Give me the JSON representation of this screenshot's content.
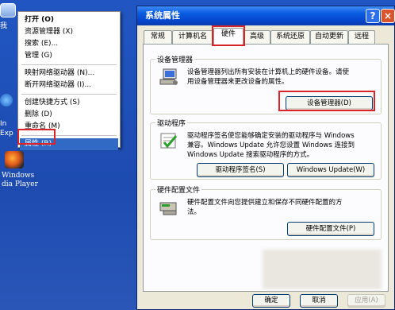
{
  "desktop": {
    "icon_partial_label": "我",
    "hidden_label_1": "In",
    "hidden_label_2": "Exp",
    "media_player_label_line1": "Windows",
    "media_player_label_line2": "dia Player"
  },
  "context_menu": {
    "items": [
      {
        "label": "打开 (O)"
      },
      {
        "label": "资源管理器 (X)"
      },
      {
        "label": "搜索 (E)..."
      },
      {
        "label": "管理 (G)"
      },
      {
        "label": "映射网络驱动器 (N)..."
      },
      {
        "label": "断开网络驱动器 (I)..."
      },
      {
        "label": "创建快捷方式 (S)"
      },
      {
        "label": "删除 (D)"
      },
      {
        "label": "重命名 (M)"
      },
      {
        "label": "属性 (R)"
      }
    ]
  },
  "dialog": {
    "title": "系统属性",
    "help_glyph": "?",
    "close_glyph": "×",
    "tabs": [
      {
        "label": "常规"
      },
      {
        "label": "计算机名"
      },
      {
        "label": "硬件"
      },
      {
        "label": "高级"
      },
      {
        "label": "系统还原"
      },
      {
        "label": "自动更新"
      },
      {
        "label": "远程"
      }
    ],
    "active_tab": "硬件",
    "device_manager": {
      "title": "设备管理器",
      "desc_line1": "设备管理器列出所有安装在计算机上的硬件设备。请使",
      "desc_line2": "用设备管理器来更改设备的属性。",
      "button": "设备管理器(D)"
    },
    "drivers": {
      "title": "驱动程序",
      "desc_line1": "驱动程序签名使您能够确定安装的驱动程序与 Windows",
      "desc_line2": "兼容。Windows Update 允许您设置 Windows 连接到",
      "desc_line3": "Windows Update 搜索驱动程序的方式。",
      "button_signing": "驱动程序签名(S)",
      "button_update": "Windows Update(W)"
    },
    "hardware_profiles": {
      "title": "硬件配置文件",
      "desc_line1": "硬件配置文件向您提供建立和保存不同硬件配置的方",
      "desc_line2": "法。",
      "button": "硬件配置文件(P)"
    },
    "footer": {
      "ok": "确定",
      "cancel": "取消",
      "apply": "应用(A)"
    }
  },
  "colors": {
    "desktop_blue": "#1f4fb6",
    "highlight_red": "#d9242a",
    "menu_selection": "#316ac5",
    "dialog_face": "#ece9d8"
  }
}
